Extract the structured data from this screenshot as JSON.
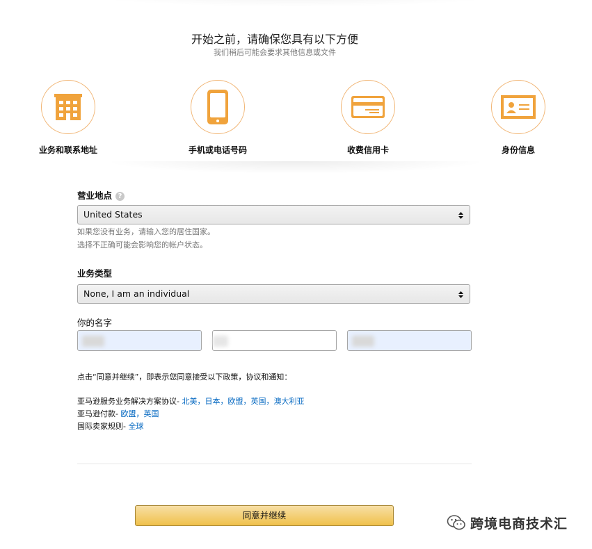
{
  "header": {
    "title": "开始之前，请确保您具有以下方便",
    "subtitle": "我们稍后可能会要求其他信息或文件"
  },
  "requirements": [
    {
      "label": "业务和联系地址",
      "icon": "building-icon"
    },
    {
      "label": "手机或电话号码",
      "icon": "phone-icon"
    },
    {
      "label": "收费信用卡",
      "icon": "credit-card-icon"
    },
    {
      "label": "身份信息",
      "icon": "id-card-icon"
    }
  ],
  "business_location": {
    "label": "营业地点",
    "help_icon": "?",
    "value": "United States",
    "hint_line1": "如果您没有业务，请输入您的居住国家。",
    "hint_line2": "选择不正确可能会影响您的帐户状态。"
  },
  "business_type": {
    "label": "业务类型",
    "value": "None, I am an individual"
  },
  "your_name": {
    "label": "你的名字"
  },
  "agreement": {
    "intro": "点击“同意并继续”，即表示您同意接受以下政策，协议和通知：",
    "line1_prefix": "亚马逊服务业务解决方案协议- ",
    "line1_links": [
      "北美",
      "日本",
      "欧盟",
      "英国",
      "澳大利亚"
    ],
    "line2_prefix": "亚马逊付款- ",
    "line2_links": [
      "欧盟",
      "英国"
    ],
    "line3_prefix": "国际卖家规则- ",
    "line3_links": [
      "全球"
    ],
    "separator": "，"
  },
  "submit": {
    "label": "同意并继续"
  },
  "watermark": {
    "text": "跨境电商技术汇",
    "icon": "wechat-icon"
  },
  "colors": {
    "accent_orange": "#f0a33c",
    "link_blue": "#0066c0",
    "button_yellow": "#f0c14b"
  }
}
